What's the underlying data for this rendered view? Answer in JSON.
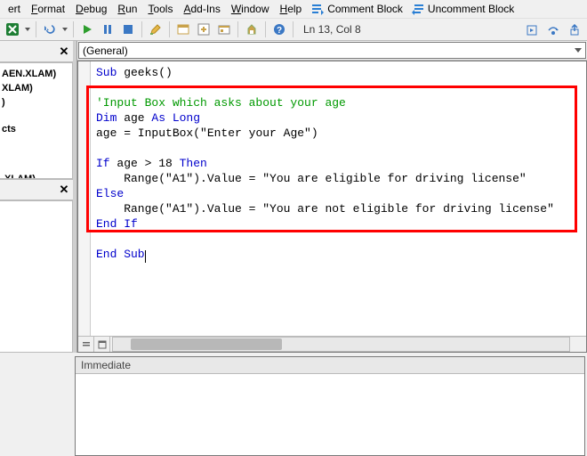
{
  "menu": {
    "items": [
      "ert",
      "Format",
      "Debug",
      "Run",
      "Tools",
      "Add-Ins",
      "Window",
      "Help"
    ],
    "comment": "Comment Block",
    "uncomment": "Uncomment Block"
  },
  "toolbar": {
    "status": "Ln 13, Col 8"
  },
  "tree": {
    "i0": "AEN.XLAM)",
    "i1": "XLAM)",
    "i2": ")",
    "i3": "cts",
    "i4": ".XLAM)"
  },
  "dropdown": {
    "object": "(General)"
  },
  "code": {
    "l1a": "Sub",
    "l1b": " geeks()",
    "l3": "'Input Box which asks about your age",
    "l4a": "Dim",
    "l4b": " age ",
    "l4c": "As Long",
    "l5a": "age = InputBox(",
    "l5b": "\"Enter your Age\"",
    "l5c": ")",
    "l7a": "If",
    "l7b": " age > 18 ",
    "l7c": "Then",
    "l8a": "    Range(",
    "l8b": "\"A1\"",
    "l8c": ").Value = ",
    "l8d": "\"You are eligible for driving license\"",
    "l9": "Else",
    "l10a": "    Range(",
    "l10b": "\"A1\"",
    "l10c": ").Value = ",
    "l10d": "\"You are not eligible for driving license\"",
    "l11": "End If",
    "l13": "End Sub"
  },
  "immediate": {
    "title": "Immediate"
  }
}
